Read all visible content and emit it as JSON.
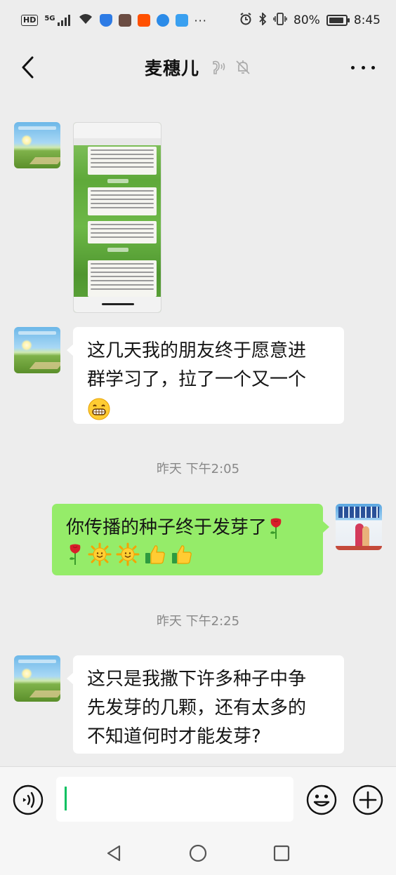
{
  "status_bar": {
    "hd_badge": "HD",
    "signal": "5G",
    "battery_percent": "80%",
    "time": "8:45"
  },
  "header": {
    "title": "麦穗儿"
  },
  "messages": [
    {
      "type": "image",
      "side": "left"
    },
    {
      "type": "text",
      "side": "left",
      "line1": "这几天我的朋友终于愿意进",
      "line2": "群学习了，拉了一个又一个"
    },
    {
      "type": "timestamp",
      "text": "昨天 下午2:05"
    },
    {
      "type": "text",
      "side": "right",
      "line1": "你传播的种子终于发芽了"
    },
    {
      "type": "timestamp",
      "text": "昨天 下午2:25"
    },
    {
      "type": "text",
      "side": "left",
      "line1": "这只是我撒下许多种子中争",
      "line2": "先发芽的几颗，还有太多的",
      "line3": "不知道何时才能发芽?"
    }
  ],
  "input_bar": {
    "value": ""
  },
  "icons": {
    "back": "chevron-left-icon",
    "voice_call": "voice-earpiece-icon",
    "mute": "bell-off-icon",
    "more": "more-dots-icon",
    "voice": "voice-input-icon",
    "emoji": "smiley-icon",
    "plus": "plus-circle-icon"
  },
  "colors": {
    "background": "#ededed",
    "bubble_right": "#95ec69",
    "bubble_left": "#ffffff",
    "caret": "#07c160"
  }
}
